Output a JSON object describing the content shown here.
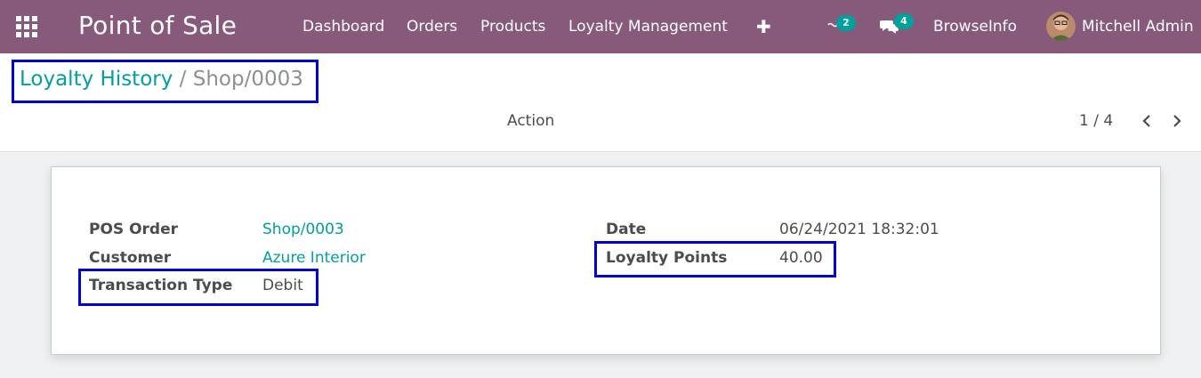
{
  "navbar": {
    "app_title": "Point of Sale",
    "menu": [
      "Dashboard",
      "Orders",
      "Products",
      "Loyalty Management"
    ],
    "activity_count": "2",
    "messages_count": "4",
    "company": "BrowseInfo",
    "user": "Mitchell Admin",
    "colors": {
      "bar": "#875a7b",
      "badge": "#00a09d"
    }
  },
  "control_panel": {
    "breadcrumb_parent": "Loyalty History",
    "breadcrumb_separator": "/",
    "breadcrumb_current": "Shop/0003",
    "action_label": "Action",
    "pager": "1 / 4"
  },
  "form": {
    "pos_order_label": "POS Order",
    "pos_order_value": "Shop/0003",
    "customer_label": "Customer",
    "customer_value": "Azure Interior",
    "transaction_type_label": "Transaction Type",
    "transaction_type_value": "Debit",
    "date_label": "Date",
    "date_value": "06/24/2021 18:32:01",
    "loyalty_points_label": "Loyalty Points",
    "loyalty_points_value": "40.00"
  },
  "icons": [
    "apps-grid-icon",
    "plus-icon",
    "activity-icon",
    "chat-icon",
    "chevron-left-icon",
    "chevron-right-icon"
  ]
}
